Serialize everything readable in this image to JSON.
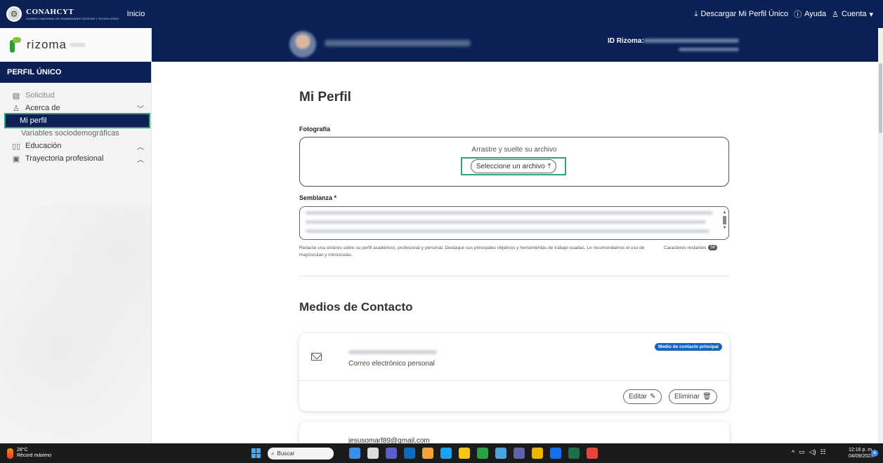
{
  "topbar": {
    "brand": "CONAHCYT",
    "brand_sub": "CONSEJO NACIONAL DE HUMANIDADES CIENCIAS Y TECNOLOGÍAS",
    "home_link": "Inicio",
    "download_label": "Descargar Mi Perfil Único",
    "help_label": "Ayuda",
    "account_label": "Cuenta"
  },
  "sidebar": {
    "logo_text": "rizoma",
    "section_header": "PERFIL ÚNICO",
    "items": [
      {
        "label": "Solicitud",
        "icon": "document-icon"
      },
      {
        "label": "Acerca de",
        "icon": "person-icon"
      },
      {
        "label": "Mi perfil"
      },
      {
        "label": "Variables sociodemográficas"
      },
      {
        "label": "Educación",
        "icon": "book-icon"
      },
      {
        "label": "Trayectoria profesional",
        "icon": "badge-icon"
      }
    ]
  },
  "profile_band": {
    "id_label": "ID Rizoma:"
  },
  "main": {
    "page_title": "Mi Perfil",
    "photo_label": "Fotografía",
    "dropzone_text": "Arrastre y suelte su archivo",
    "select_file_label": "Seleccione un archivo",
    "bio_label": "Semblanza *",
    "bio_hint": "Redacte una síntesis sobre su perfil académico, profesional y personal. Destaque sus principales objetivos y herramientas de trabajo usadas. Le recomendamos el uso de mayúsculas y minúsculas.",
    "remaining_label": "Caracteres restantes",
    "remaining_count": "56",
    "contact_section_title": "Medios de Contacto",
    "contacts": [
      {
        "type": "Correo electrónico personal",
        "badge": "Medio de contacto principal",
        "edit_label": "Editar",
        "delete_label": "Eliminar"
      },
      {
        "email": "jesusomarf89@gmail.com"
      }
    ]
  },
  "taskbar": {
    "temperature": "28°C",
    "weather_text": "Récord máximo",
    "search_placeholder": "Buscar",
    "time": "12:16 p. m.",
    "date": "04/09/2023"
  },
  "colors": {
    "navy": "#0b2155",
    "highlight_outline": "#2ba37b",
    "badge_blue": "#1565c0"
  }
}
